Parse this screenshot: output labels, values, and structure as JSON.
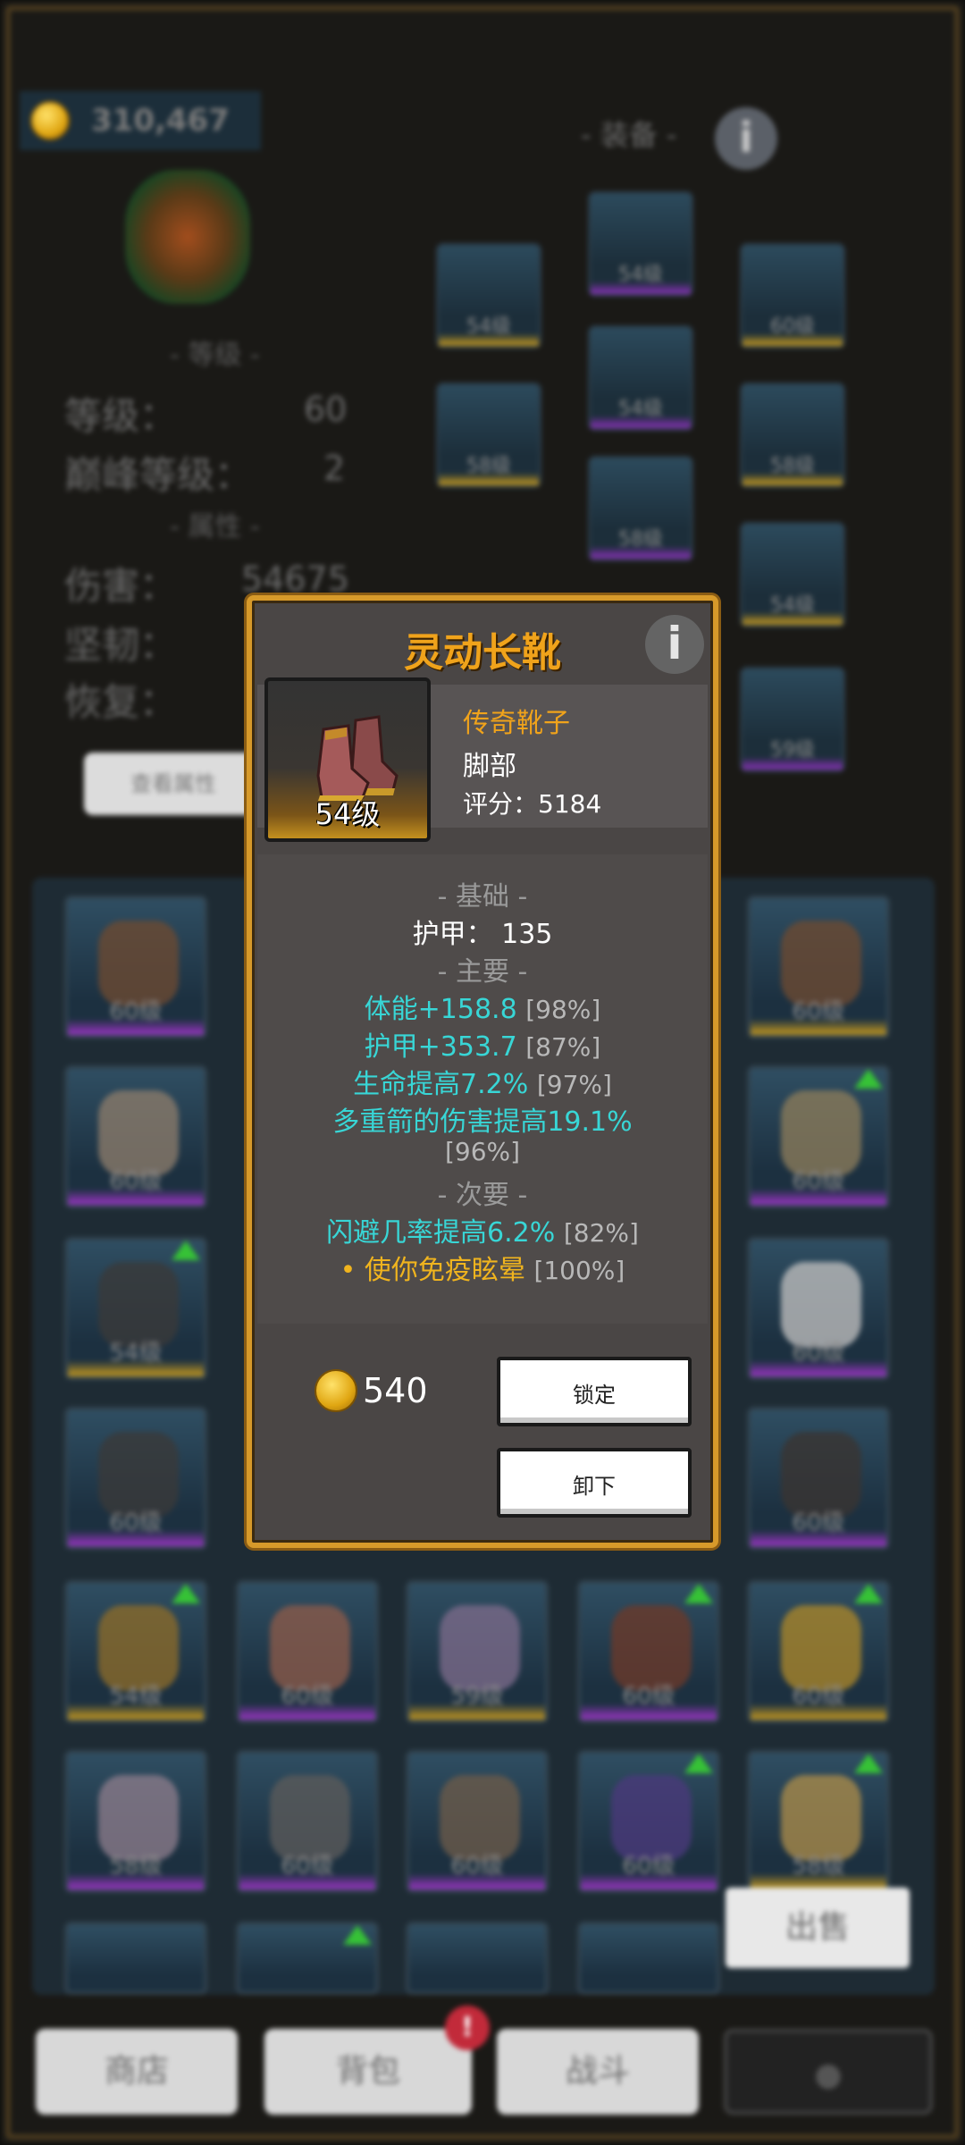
{
  "background": {
    "gold": "310,467",
    "equipment_title": "- 装备 -",
    "level_section": "- 等级 -",
    "attr_section": "- 属性 -",
    "level_label": "等级：",
    "level_value": "60",
    "peak_label": "巅峰等级：",
    "peak_value": "2",
    "damage_label": "伤害：",
    "damage_value": "54675",
    "toughness_label": "坚韧：",
    "recovery_label": "恢复：",
    "view_button": "查看属性",
    "equip_slot_levels": [
      "54级",
      "54级",
      "60级",
      "58级",
      "54级",
      "58级",
      "58级",
      "54级",
      "59级"
    ],
    "bag_levels": [
      "60级",
      "60级",
      "60级",
      "60级",
      "54级",
      "60级",
      "60级",
      "60级",
      "54级",
      "60级",
      "59级",
      "60级",
      "60级",
      "58级",
      "60级",
      "60级",
      "60级",
      "58级"
    ],
    "sell_button": "出售",
    "nav": {
      "shop": "商店",
      "bag": "背包",
      "battle": "战斗",
      "badge": "!"
    }
  },
  "popup": {
    "title": "灵动长靴",
    "info_icon": "i",
    "item_level": "54级",
    "item_type": "传奇靴子",
    "item_slot": "脚部",
    "score_label": "评分：",
    "score": "5184",
    "basic_header": "- 基础 -",
    "basic_stat": "护甲： 135",
    "main_header": "- 主要 -",
    "main_stats": [
      {
        "text": "体能+158.8",
        "pct": "[98%]"
      },
      {
        "text": "护甲+353.7",
        "pct": "[87%]"
      },
      {
        "text": "生命提高7.2%",
        "pct": "[97%]"
      },
      {
        "text": "多重箭的伤害提高19.1%",
        "pct": "[96%]"
      }
    ],
    "secondary_header": "- 次要 -",
    "secondary_stats": [
      {
        "text": "闪避几率提高6.2%",
        "pct": "[82%]"
      },
      {
        "text": "• 使你免疫眩晕",
        "pct": "[100%]"
      }
    ],
    "price": "540",
    "lock_button": "锁定",
    "unequip_button": "卸下"
  },
  "colors": {
    "title_orange": "#f0a31b",
    "stat_cyan": "#38d6d6",
    "legendary_yellow": "#f0b41e",
    "popup_border": "#d79a2a"
  }
}
